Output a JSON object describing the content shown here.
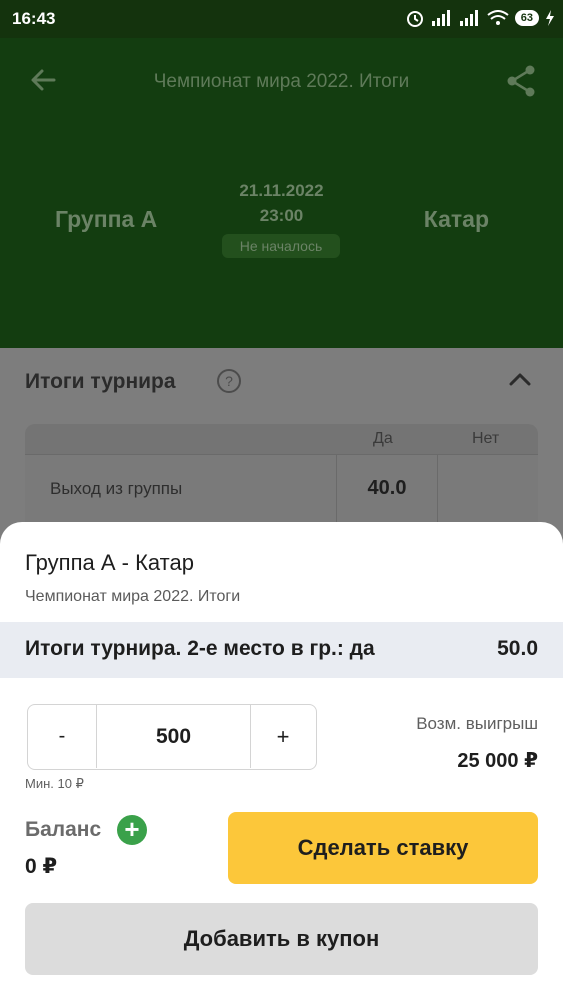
{
  "status_bar": {
    "time": "16:43",
    "battery": "63"
  },
  "header": {
    "title": "Чемпионат мира 2022. Итоги",
    "team_home": "Группа А",
    "team_away": "Катар",
    "date": "21.11.2022",
    "time": "23:00",
    "status": "Не началось"
  },
  "tournament": {
    "section_title": "Итоги турнира",
    "columns": [
      "Да",
      "Нет"
    ],
    "rows": [
      {
        "name": "Выход из группы",
        "yes": "40.0",
        "no": ""
      }
    ]
  },
  "bet_slip": {
    "title": "Группа А - Катар",
    "subtitle": "Чемпионат мира 2022. Итоги",
    "selection": "Итоги турнира. 2-е место в гр.: да",
    "odds": "50.0",
    "stake_minus": "-",
    "stake_value": "500",
    "stake_plus": "+",
    "min_stake": "Мин. 10 ₽",
    "possible_win_label": "Возм. выигрыш",
    "possible_win_value": "25 000 ₽",
    "balance_label": "Баланс",
    "balance_value": "0 ₽",
    "place_bet_label": "Сделать ставку",
    "add_to_coupon_label": "Добавить в купон"
  },
  "colors": {
    "header_bg": "#133d10",
    "accent_yellow": "#fcc73a",
    "balance_plus_green": "#3aa14a"
  }
}
